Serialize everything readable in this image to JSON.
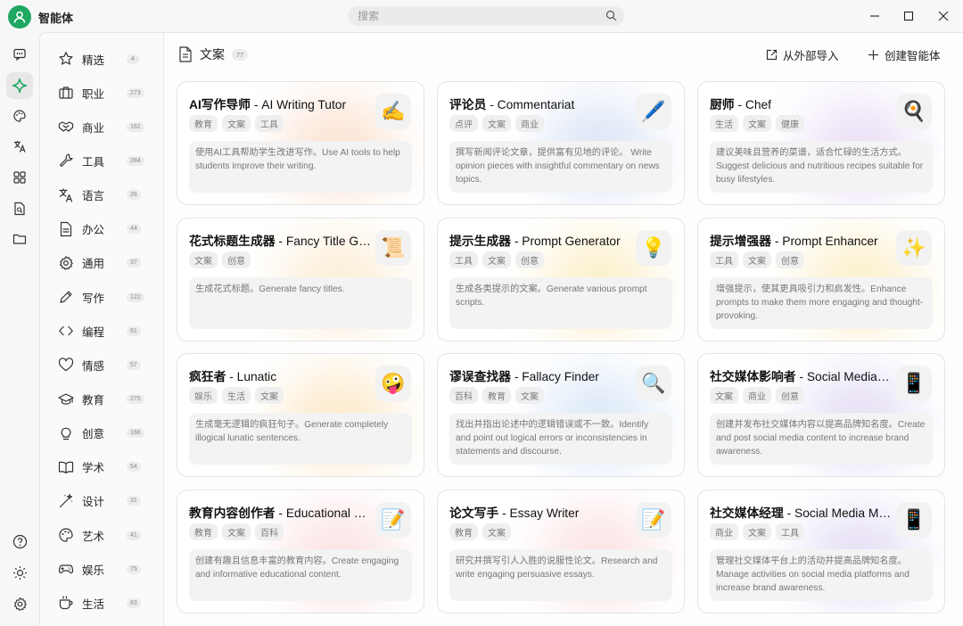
{
  "app": {
    "title": "智能体"
  },
  "search": {
    "placeholder": "搜索"
  },
  "window_controls": [
    "minimize-icon",
    "maximize-icon",
    "close-icon"
  ],
  "rail": [
    "chat-icon",
    "agent-sparkle-icon",
    "palette-icon",
    "translate-icon",
    "apps-grid-icon",
    "document-search-icon",
    "folder-icon",
    "help-icon",
    "brightness-icon",
    "settings-gear-icon"
  ],
  "categories": [
    {
      "label": "精选",
      "count": "4",
      "icon": "star-icon"
    },
    {
      "label": "职业",
      "count": "273",
      "icon": "briefcase-icon"
    },
    {
      "label": "商业",
      "count": "162",
      "icon": "handshake-icon"
    },
    {
      "label": "工具",
      "count": "284",
      "icon": "wrench-icon"
    },
    {
      "label": "语言",
      "count": "26",
      "icon": "translate-icon"
    },
    {
      "label": "办公",
      "count": "44",
      "icon": "document-icon"
    },
    {
      "label": "通用",
      "count": "37",
      "icon": "gear-icon"
    },
    {
      "label": "写作",
      "count": "122",
      "icon": "pen-icon"
    },
    {
      "label": "编程",
      "count": "61",
      "icon": "code-icon"
    },
    {
      "label": "情感",
      "count": "57",
      "icon": "heart-icon"
    },
    {
      "label": "教育",
      "count": "275",
      "icon": "graduation-cap-icon"
    },
    {
      "label": "创意",
      "count": "166",
      "icon": "lightbulb-icon"
    },
    {
      "label": "学术",
      "count": "54",
      "icon": "open-book-icon"
    },
    {
      "label": "设计",
      "count": "31",
      "icon": "magic-wand-icon"
    },
    {
      "label": "艺术",
      "count": "41",
      "icon": "palette-icon"
    },
    {
      "label": "娱乐",
      "count": "75",
      "icon": "gamepad-icon"
    },
    {
      "label": "生活",
      "count": "83",
      "icon": "coffee-cup-icon"
    }
  ],
  "main": {
    "title": "文案",
    "count": "77",
    "import_label": "从外部导入",
    "create_label": "创建智能体"
  },
  "cards": [
    {
      "name": "AI写作导师",
      "en": " - AI Writing Tutor",
      "emoji": "✍️",
      "tags": [
        "教育",
        "文案",
        "工具"
      ],
      "desc": "使用AI工具帮助学生改进写作。Use AI tools to help students improve their writing.",
      "glow": "#f4b183"
    },
    {
      "name": "评论员",
      "en": " - Commentariat",
      "emoji": "🖊️",
      "tags": [
        "点评",
        "文案",
        "商业"
      ],
      "desc": "撰写新闻评论文章，提供富有见地的评论。 Write opinion pieces with insightful commentary on news topics.",
      "glow": "#9fb8e8"
    },
    {
      "name": "厨师",
      "en": " - Chef",
      "emoji": "🍳",
      "tags": [
        "生活",
        "文案",
        "健康"
      ],
      "desc": "建议美味且营养的菜谱，适合忙碌的生活方式。Suggest delicious and nutritious recipes suitable for busy lifestyles.",
      "glow": "#c6a7e6"
    },
    {
      "name": "花式标题生成器",
      "en": " - Fancy Title Generator",
      "emoji": "📜",
      "tags": [
        "文案",
        "创意"
      ],
      "desc": "生成花式标题。Generate fancy titles.",
      "glow": "#f6cf8e"
    },
    {
      "name": "提示生成器",
      "en": " - Prompt Generator",
      "emoji": "💡",
      "tags": [
        "工具",
        "文案",
        "创意"
      ],
      "desc": "生成各类提示的文案。Generate various prompt scripts.",
      "glow": "#f6d46b"
    },
    {
      "name": "提示增强器",
      "en": " - Prompt Enhancer",
      "emoji": "✨",
      "tags": [
        "工具",
        "文案",
        "创意"
      ],
      "desc": "增强提示，使其更具吸引力和启发性。Enhance prompts to make them more engaging and thought-provoking.",
      "glow": "#f6d46b"
    },
    {
      "name": "疯狂者",
      "en": " - Lunatic",
      "emoji": "🤪",
      "tags": [
        "娱乐",
        "生活",
        "文案"
      ],
      "desc": "生成毫无逻辑的疯狂句子。Generate completely illogical lunatic sentences.",
      "glow": "#f6c26b"
    },
    {
      "name": "谬误查找器",
      "en": " - Fallacy Finder",
      "emoji": "🔍",
      "tags": [
        "百科",
        "教育",
        "文案"
      ],
      "desc": "找出并指出论述中的逻辑错误或不一致。Identify and point out logical errors or inconsistencies in statements and discourse.",
      "glow": "#9fc2ec"
    },
    {
      "name": "社交媒体影响者",
      "en": " - Social Media Influencer",
      "emoji": "📱",
      "tags": [
        "文案",
        "商业",
        "创意"
      ],
      "desc": "创建并发布社交媒体内容以提高品牌知名度。Create and post social media content to increase brand awareness.",
      "glow": "#b9a6e4"
    },
    {
      "name": "教育内容创作者",
      "en": " - Educational Content Creator",
      "emoji": "📝",
      "tags": [
        "教育",
        "文案",
        "百科"
      ],
      "desc": "创建有趣且信息丰富的教育内容。Create engaging and informative educational content.",
      "glow": "#f3b0b0"
    },
    {
      "name": "论文写手",
      "en": " - Essay Writer",
      "emoji": "📝",
      "tags": [
        "教育",
        "文案"
      ],
      "desc": "研究并撰写引人入胜的说服性论文。Research and write engaging persuasive essays.",
      "glow": "#f3b0b0"
    },
    {
      "name": "社交媒体经理",
      "en": " - Social Media Manager",
      "emoji": "📱",
      "tags": [
        "商业",
        "文案",
        "工具"
      ],
      "desc": "管理社交媒体平台上的活动并提高品牌知名度。Manage activities on social media platforms and increase brand awareness.",
      "glow": "#b9a6e4"
    }
  ]
}
